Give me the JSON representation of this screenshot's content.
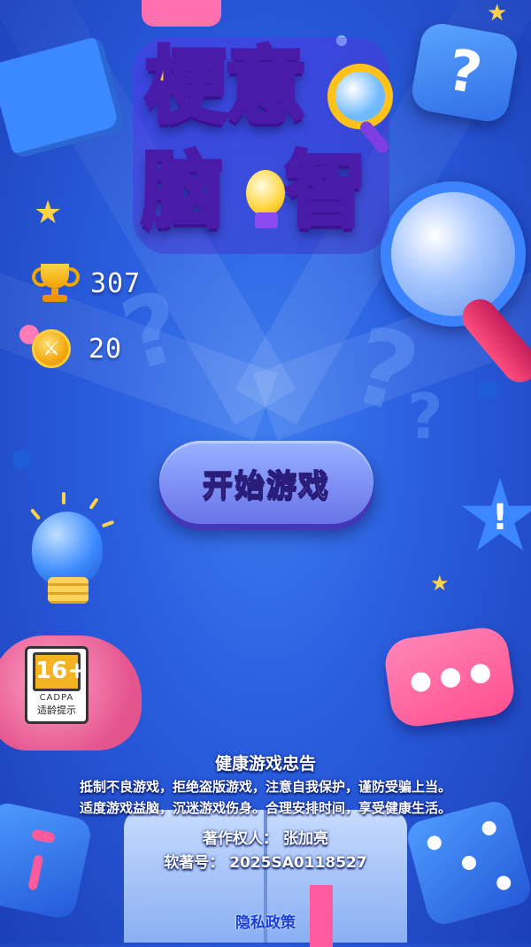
{
  "logo": {
    "line1": "梗意",
    "line2_a": "脑",
    "line2_b": "智"
  },
  "stats": {
    "score": "307",
    "coins": "20"
  },
  "start_button": {
    "label": "开始游戏"
  },
  "age_rating": {
    "age": "16+",
    "org": "CADPA",
    "tip": "适龄提示"
  },
  "notice": {
    "title": "健康游戏忠告",
    "line1": "抵制不良游戏，拒绝盗版游戏，注意自我保护，谨防受骗上当。",
    "line2": "适度游戏益脑，沉迷游戏伤身。合理安排时间，享受健康生活。"
  },
  "copyright": "著作权人：  张加亮",
  "registration": "软著号：  2025SA0118527",
  "privacy_link": "隐私政策",
  "icons": [
    "trophy-icon",
    "coin-icon",
    "magnifier-icon",
    "lightbulb-icon",
    "question-bubble-icon",
    "chat-bubble-icon",
    "brain-icon",
    "dice-icon",
    "book-icon",
    "star-icon",
    "puzzle-icon"
  ],
  "colors": {
    "accent": "#7d8ff4",
    "background": "#2a5fe0",
    "gold": "#ffd43a",
    "link": "#1a3ed8"
  }
}
